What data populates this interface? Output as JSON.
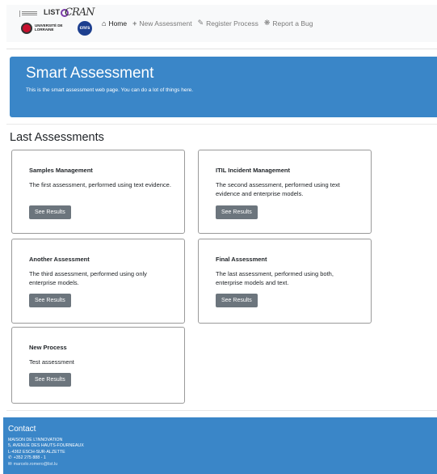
{
  "nav": {
    "brand_logos": {
      "list_text": "LIST",
      "cran_text": "CRAN",
      "ul_text": "UNIVERSITÉ DE LORRAINE",
      "cnrs_text": "cnrs"
    },
    "items": [
      {
        "label": "Home",
        "icon": "home-icon",
        "active": true
      },
      {
        "label": "New Assessment",
        "icon": "plus-icon",
        "active": false
      },
      {
        "label": "Register Process",
        "icon": "pencil-icon",
        "active": false
      },
      {
        "label": "Report a Bug",
        "icon": "bug-icon",
        "active": false
      }
    ]
  },
  "hero": {
    "title": "Smart Assessment",
    "lead": "This is the smart assessment web page. You can do a lot of things here."
  },
  "section_title": "Last Assessments",
  "cards": [
    {
      "title": "Samples Management",
      "text": "The first assessment, performed using text evidence.",
      "button": "See Results"
    },
    {
      "title": "ITIL Incident Management",
      "text": "The second assessment, performed using text evidence and enterprise models.",
      "button": "See Results"
    },
    {
      "title": "Another Assessment",
      "text": "The third assessment, performed using only enterprise models.",
      "button": "See Results"
    },
    {
      "title": "Final Assessment",
      "text": "The last assessment, performed using both, enterprise models and text.",
      "button": "See Results"
    },
    {
      "title": "New Process",
      "text": "Test assessment",
      "button": "See Results"
    }
  ],
  "footer": {
    "title": "Contact",
    "address_line1": "MAISON DE L'INNOVATION",
    "address_line2": "5, AVENUE DES HAUTS-FOURNEAUX",
    "address_line3": "L-4362 ESCH-SUR-ALZETTE",
    "phone": "+352 275 888 - 1",
    "email": "marcelo.romero@list.lu"
  },
  "colors": {
    "primary": "#3a86c8",
    "navbar_bg": "#f8f9fa",
    "button_bg": "#6c757d"
  }
}
